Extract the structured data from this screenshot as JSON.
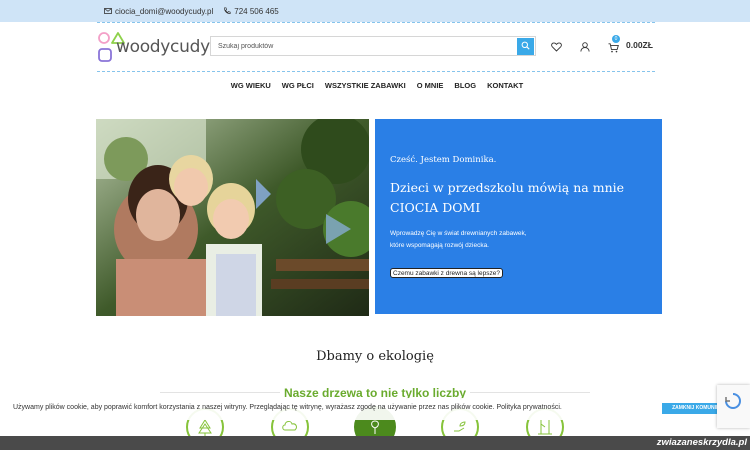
{
  "topbar": {
    "email": "ciocia_domi@woodycudy.pl",
    "phone": "724 506 465",
    "email_icon": "envelope-icon",
    "phone_icon": "phone-icon"
  },
  "header": {
    "logo_text": "woodycudy",
    "search_placeholder": "Szukaj produktów",
    "cart_count": "0",
    "cart_total": "0.00ZŁ",
    "icons": [
      "search-icon",
      "heart-icon",
      "user-icon",
      "cart-icon"
    ]
  },
  "nav": {
    "items": [
      "WG WIEKU",
      "WG PŁCI",
      "WSZYSTKIE ZABAWKI",
      "O MNIE",
      "BLOG",
      "KONTAKT"
    ]
  },
  "hero": {
    "hello": "Cześć. Jestem Dominika.",
    "headline": "Dzieci w przedszkolu mówią na mnie CIOCIA DOMI",
    "sub_line1": "Wprowadzę Cię w świat drewnianych zabawek,",
    "sub_line2": "które wspomagają rozwój dziecka.",
    "cta": "Czemu zabawki z drewna są lepsze?"
  },
  "eco": {
    "title": "Dbamy o ekologię",
    "trees_title": "Nasze drzewa to nie tylko liczby"
  },
  "cookie": {
    "text": "Używamy plików cookie, aby poprawić komfort korzystania z naszej witryny. Przeglądając tę witrynę, wyrażasz zgodę na używanie przez nas plików cookie. Polityka prywatności.",
    "button": "ZAMKNIJ KOMUNIKAT"
  },
  "watermark": "zwiazaneskrzydla.pl",
  "colors": {
    "accent_blue": "#3aa9e8",
    "hero_blue": "#2a7fe6",
    "eco_green": "#6aab2e",
    "topbar_bg": "#cfe4f7"
  }
}
